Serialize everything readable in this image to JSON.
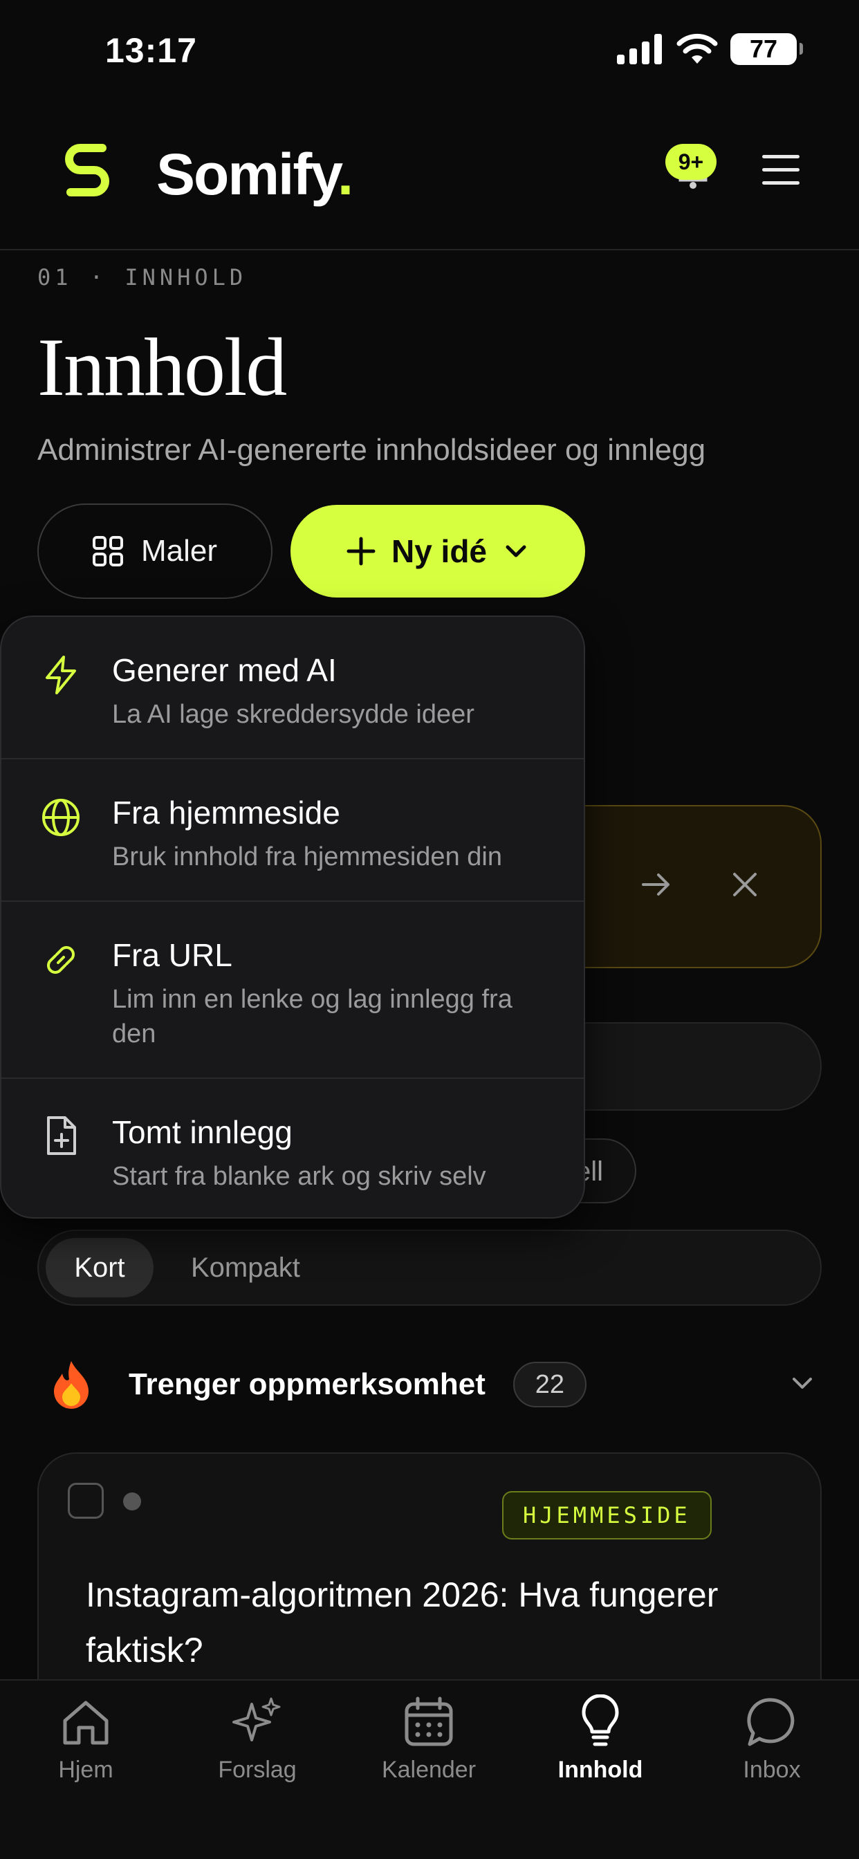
{
  "status_bar": {
    "time": "13:17",
    "battery": "77"
  },
  "header": {
    "brand": "Somify",
    "brand_dot": ".",
    "notification_count": "9+"
  },
  "page": {
    "eyebrow": "01 · INNHOLD",
    "title": "Innhold",
    "subtitle": "Administrer AI-genererte innholdsideer og innlegg"
  },
  "actions": {
    "templates_label": "Maler",
    "new_idea_label": "Ny idé"
  },
  "dropdown": {
    "items": [
      {
        "title": "Generer med AI",
        "desc": "La AI lage skreddersydde ideer",
        "icon": "lightning-icon"
      },
      {
        "title": "Fra hjemmeside",
        "desc": "Bruk innhold fra hjemmesiden din",
        "icon": "globe-icon"
      },
      {
        "title": "Fra URL",
        "desc": "Lim inn en lenke og lag innlegg fra den",
        "icon": "link-icon"
      },
      {
        "title": "Tomt innlegg",
        "desc": "Start fra blanke ark og skriv selv",
        "icon": "file-plus-icon"
      }
    ]
  },
  "filters": {
    "partial_label": "ell"
  },
  "view_toggle": {
    "active": "Kort",
    "other": "Kompakt"
  },
  "section": {
    "title": "Trenger oppmerksomhet",
    "count": "22",
    "icon": "fire-emoji"
  },
  "post": {
    "source_badge": "HJEMMESIDE",
    "title": "Instagram-algoritmen 2026: Hva fungerer faktisk?"
  },
  "bottom_nav": {
    "items": [
      {
        "label": "Hjem",
        "icon": "home-icon"
      },
      {
        "label": "Forslag",
        "icon": "sparkles-icon"
      },
      {
        "label": "Kalender",
        "icon": "calendar-icon"
      },
      {
        "label": "Innhold",
        "icon": "lightbulb-icon",
        "active": true
      },
      {
        "label": "Inbox",
        "icon": "chat-icon"
      }
    ]
  },
  "colors": {
    "accent": "#d6ff3f",
    "background": "#0a0a0a",
    "menu_bg": "#18181b"
  }
}
